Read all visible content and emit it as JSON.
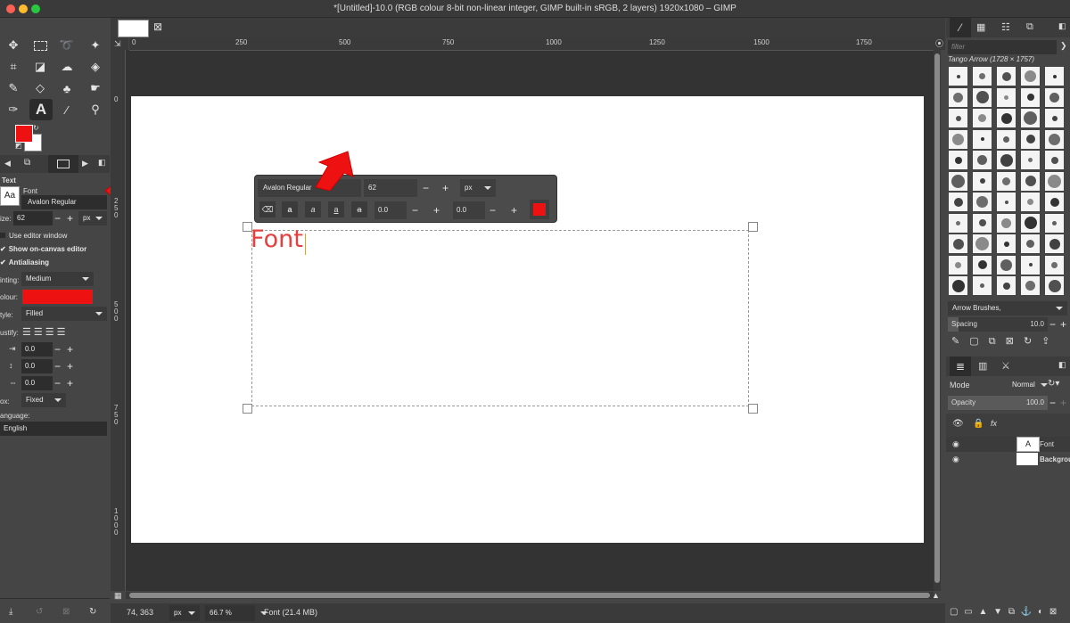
{
  "window": {
    "title": "*[Untitled]-10.0 (RGB colour 8-bit non-linear integer, GIMP built-in sRGB, 2 layers) 1920x1080 – GIMP"
  },
  "colors": {
    "foreground": "#ee1111",
    "background": "#ffffff",
    "text_color": "#ee1111",
    "accent_arrow": "#ee1111"
  },
  "toolbox": {
    "tools": [
      "move-icon",
      "rect-select-icon",
      "lasso-icon",
      "fuzzy-select-icon",
      "crop-icon",
      "transform-icon",
      "warp-icon",
      "fill-icon",
      "paintbrush-icon",
      "eraser-icon",
      "clone-icon",
      "smudge-icon",
      "paths-icon",
      "text-tool-icon",
      "color-picker-icon",
      "zoom-icon"
    ]
  },
  "tool_options": {
    "section": "Text",
    "font_label": "Font",
    "font_preview": "Aa",
    "font_value": "Avalon Regular",
    "size_label": "ize:",
    "size_value": "62",
    "size_unit": "px",
    "use_editor": "Use editor window",
    "show_editor": "Show on-canvas editor",
    "antialiasing": "Antialiasing",
    "hinting_label": "inting:",
    "hinting_value": "Medium",
    "colour_label": "olour:",
    "style_label": "tyle:",
    "style_value": "Filled",
    "justify_label": "ustify:",
    "indent_value": "0.0",
    "line_spacing_value": "0.0",
    "letter_spacing_value": "0.0",
    "box_label": "ox:",
    "box_value": "Fixed",
    "language_label": "anguage:",
    "language_value": "English"
  },
  "canvas": {
    "ruler_h": [
      "0",
      "250",
      "500",
      "750",
      "1000",
      "1250",
      "1500",
      "1750"
    ],
    "ruler_v": [
      "0",
      "2\n5\n0",
      "5\n0\n0",
      "7\n5\n0",
      "1\n0\n0\n0"
    ],
    "text_layer_content": "Font"
  },
  "on_canvas_editor": {
    "font": "Avalon Regular",
    "size": "62",
    "unit": "px",
    "baseline": "0.0",
    "kerning": "0.0"
  },
  "status": {
    "coords": "74, 363",
    "unit": "px",
    "zoom": "66.7 %",
    "info": "Font (21.4 MB)"
  },
  "brushes": {
    "filter_placeholder": "filter",
    "current": "Tango Arrow (1728 × 1757)",
    "tag": "Arrow Brushes,",
    "spacing_label": "Spacing",
    "spacing_value": "10.0"
  },
  "layers": {
    "mode_label": "Mode",
    "mode_value": "Normal",
    "opacity_label": "Opacity",
    "opacity_value": "100.0",
    "items": [
      {
        "name": "Font"
      },
      {
        "name": "Backgrou"
      }
    ]
  }
}
